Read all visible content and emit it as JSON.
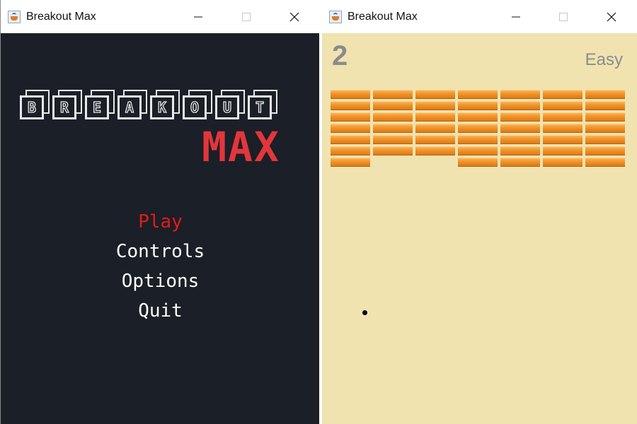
{
  "menu_window": {
    "title": "Breakout Max",
    "logo_letters": [
      "B",
      "R",
      "E",
      "A",
      "K",
      "O",
      "U",
      "T"
    ],
    "logo_subtitle": "MAX",
    "menu_items": {
      "play": "Play",
      "controls": "Controls",
      "options": "Options",
      "quit": "Quit"
    },
    "selected_item": "Play",
    "colors": {
      "background": "#1b1f27",
      "selected": "#e21b1b",
      "logo_accent": "#e2363c",
      "text": "#ffffff"
    }
  },
  "game_window": {
    "title": "Breakout Max",
    "score": "2",
    "difficulty": "Easy",
    "brick_grid": {
      "columns": 7,
      "rows": [
        [
          1,
          1,
          1,
          1,
          1,
          1,
          1
        ],
        [
          1,
          1,
          1,
          1,
          1,
          1,
          1
        ],
        [
          1,
          1,
          1,
          1,
          1,
          1,
          1
        ],
        [
          1,
          1,
          1,
          1,
          1,
          1,
          1
        ],
        [
          1,
          1,
          1,
          1,
          1,
          1,
          1
        ],
        [
          1,
          1,
          1,
          1,
          1,
          1,
          1
        ],
        [
          1,
          0,
          0,
          1,
          1,
          1,
          1
        ]
      ]
    },
    "colors": {
      "background": "#f0e3b0",
      "brick": "#f2952a",
      "ball": "#000000",
      "hud_text": "#8c8c8c"
    }
  },
  "window_controls": [
    "minimize-icon",
    "maximize-icon",
    "close-icon"
  ]
}
